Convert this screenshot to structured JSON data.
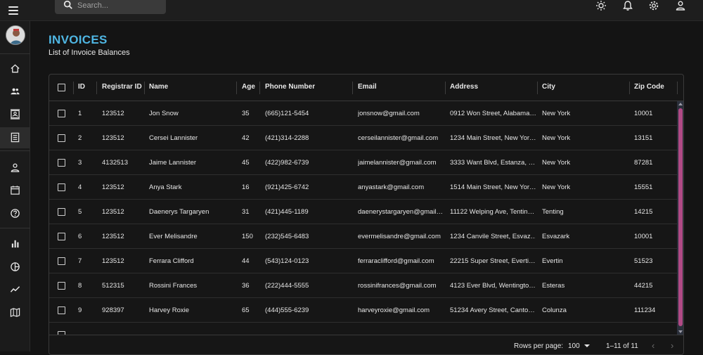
{
  "topbar": {
    "search_placeholder": "Search...",
    "icons": [
      "menu-icon",
      "search-icon",
      "sun-icon",
      "bell-icon",
      "gear-icon",
      "user-icon"
    ]
  },
  "sidebar": {
    "items": [
      {
        "icon": "home-icon"
      },
      {
        "icon": "team-icon"
      },
      {
        "icon": "contacts-icon"
      },
      {
        "icon": "invoices-icon",
        "active": true
      },
      {
        "icon": "person-icon"
      },
      {
        "icon": "calendar-icon"
      },
      {
        "icon": "help-icon"
      },
      {
        "icon": "bar-chart-icon"
      },
      {
        "icon": "pie-chart-icon"
      },
      {
        "icon": "line-chart-icon"
      },
      {
        "icon": "map-icon"
      }
    ]
  },
  "page": {
    "title": "INVOICES",
    "subtitle": "List of Invoice Balances"
  },
  "table": {
    "columns": [
      "ID",
      "Registrar ID",
      "Name",
      "Age",
      "Phone Number",
      "Email",
      "Address",
      "City",
      "Zip Code"
    ],
    "rows": [
      [
        "1",
        "123512",
        "Jon Snow",
        "35",
        "(665)121-5454",
        "jonsnow@gmail.com",
        "0912 Won Street, Alabama…",
        "New York",
        "10001"
      ],
      [
        "2",
        "123512",
        "Cersei Lannister",
        "42",
        "(421)314-2288",
        "cerseilannister@gmail.com",
        "1234 Main Street, New Yor…",
        "New York",
        "13151"
      ],
      [
        "3",
        "4132513",
        "Jaime Lannister",
        "45",
        "(422)982-6739",
        "jaimelannister@gmail.com",
        "3333 Want Blvd, Estanza, …",
        "New York",
        "87281"
      ],
      [
        "4",
        "123512",
        "Anya Stark",
        "16",
        "(921)425-6742",
        "anyastark@gmail.com",
        "1514 Main Street, New Yor…",
        "New York",
        "15551"
      ],
      [
        "5",
        "123512",
        "Daenerys Targaryen",
        "31",
        "(421)445-1189",
        "daenerystargaryen@gmail…",
        "11122 Welping Ave, Tentin…",
        "Tenting",
        "14215"
      ],
      [
        "6",
        "123512",
        "Ever Melisandre",
        "150",
        "(232)545-6483",
        "evermelisandre@gmail.com",
        "1234 Canvile Street, Esvaz…",
        "Esvazark",
        "10001"
      ],
      [
        "7",
        "123512",
        "Ferrara Clifford",
        "44",
        "(543)124-0123",
        "ferraraclifford@gmail.com",
        "22215 Super Street, Everti…",
        "Evertin",
        "51523"
      ],
      [
        "8",
        "512315",
        "Rossini Frances",
        "36",
        "(222)444-5555",
        "rossinifrances@gmail.com",
        "4123 Ever Blvd, Wentingto…",
        "Esteras",
        "44215"
      ],
      [
        "9",
        "928397",
        "Harvey Roxie",
        "65",
        "(444)555-6239",
        "harveyroxie@gmail.com",
        "51234 Avery Street, Canto…",
        "Colunza",
        "111234"
      ]
    ]
  },
  "footer": {
    "rows_per_page_label": "Rows per page:",
    "rows_per_page_value": "100",
    "range": "1–11 of 11"
  },
  "colors": {
    "accent": "#4fb6e3",
    "scroll_thumb": "#b04a85",
    "background": "#141414"
  }
}
